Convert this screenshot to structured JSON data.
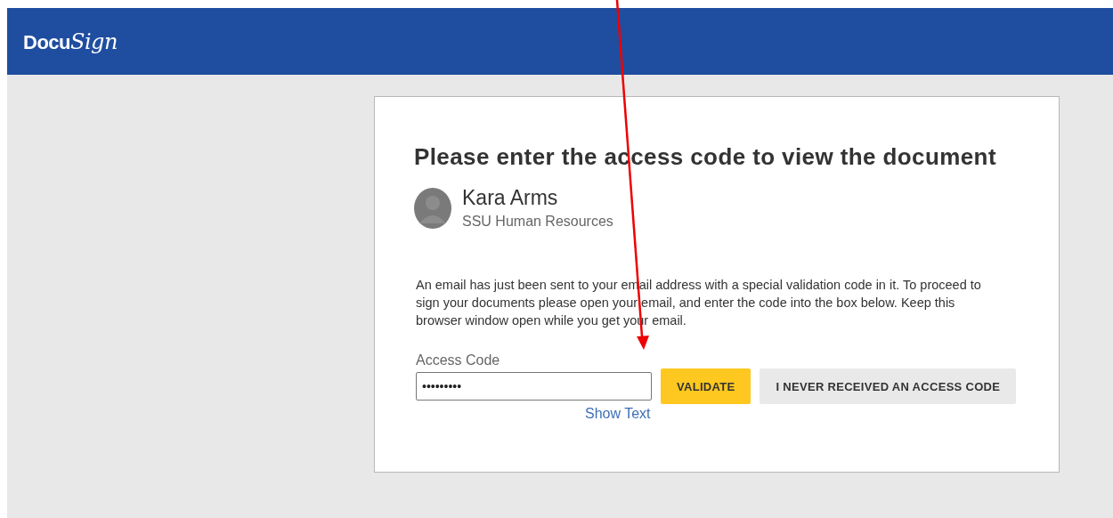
{
  "header": {
    "logo": {
      "plain": "Docu",
      "script": "Sign"
    }
  },
  "card": {
    "title": "Please enter the access code to view the document",
    "sender": {
      "name": "Kara Arms",
      "organization": "SSU Human Resources"
    },
    "message": "An email has just been sent to your email address with a special validation code in it. To proceed to sign your documents please open your email, and enter the code into the box below. Keep this browser window open while you get your email.",
    "access_code": {
      "label": "Access Code",
      "value": "•••••••••"
    },
    "buttons": [
      {
        "label": "VALIDATE",
        "kind": "primary"
      },
      {
        "label": "I NEVER RECEIVED AN ACCESS CODE",
        "kind": "secondary"
      }
    ],
    "show_text_link": "Show Text"
  }
}
